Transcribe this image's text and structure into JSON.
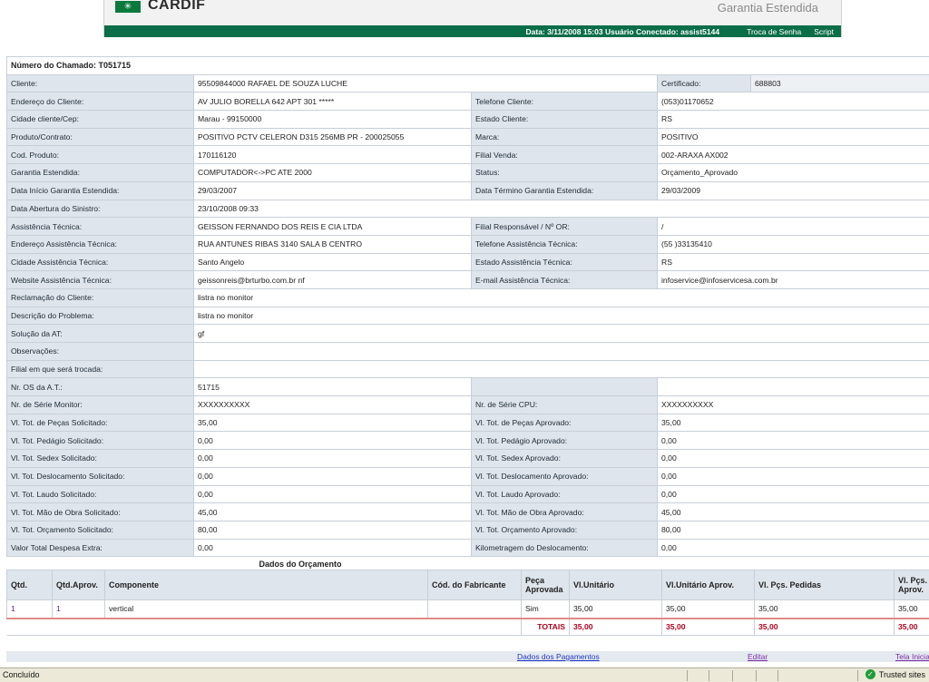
{
  "header": {
    "logo_text": "CARDIF",
    "product_title": "Garantia Estendida",
    "info": "Data: 3/11/2008 15:03  Usuário Conectado: assist5144",
    "link_senha": "Troca de Senha",
    "link_script": "Script"
  },
  "chamado": {
    "title": "Número do Chamado: T051715"
  },
  "fields": {
    "cliente": {
      "label": "Cliente:",
      "value": "95509844000  RAFAEL DE SOUZA LUCHE"
    },
    "certificado": {
      "label": "Certificado:",
      "value": "688803"
    },
    "endereco_cliente": {
      "label": "Endereço do Cliente:",
      "value": "AV JULIO BORELLA  642   APT 301   *****"
    },
    "telefone_cliente": {
      "label": "Telefone Cliente:",
      "value": "(053)01170652"
    },
    "cidade_cliente": {
      "label": "Cidade cliente/Cep:",
      "value": "Marau - 99150000"
    },
    "estado_cliente": {
      "label": "Estado Cliente:",
      "value": "RS"
    },
    "produto": {
      "label": "Produto/Contrato:",
      "value": "POSITIVO PCTV CELERON D315 256MB PR - 200025055"
    },
    "marca": {
      "label": "Marca:",
      "value": "POSITIVO"
    },
    "cod_produto": {
      "label": "Cod. Produto:",
      "value": "170116120"
    },
    "filial_venda": {
      "label": "Filial Venda:",
      "value": "002-ARAXA AX002"
    },
    "garantia": {
      "label": "Garantia Estendida:",
      "value": "COMPUTADOR<->PC ATE 2000"
    },
    "status": {
      "label": "Status:",
      "value": "Orçamento_Aprovado"
    },
    "inicio_garantia": {
      "label": "Data Início Garantia Estendida:",
      "value": "29/03/2007"
    },
    "termino_garantia": {
      "label": "Data Término Garantia Estendida:",
      "value": "29/03/2009"
    },
    "abertura_sinistro": {
      "label": "Data Abertura do Sinistro:",
      "value": "23/10/2008 09:33"
    },
    "assistencia": {
      "label": "Assistência Técnica:",
      "value": "GEISSON FERNANDO DOS REIS E CIA LTDA"
    },
    "filial_responsavel": {
      "label": "Filial Responsável / Nº OR:",
      "value": "/"
    },
    "endereco_at": {
      "label": "Endereço Assistência Técnica:",
      "value": "RUA ANTUNES RIBAS   3140   SALA B   CENTRO"
    },
    "telefone_at": {
      "label": "Telefone Assistência Técnica:",
      "value": "(55 )33135410"
    },
    "cidade_at": {
      "label": "Cidade Assistência Técnica:",
      "value": "Santo Angelo"
    },
    "estado_at": {
      "label": "Estado Assistência Técnica:",
      "value": "RS"
    },
    "website_at": {
      "label": "Website Assistência Técnica:",
      "value": "geissonreis@brturbo.com.br nf"
    },
    "email_at": {
      "label": "E-mail Assistência Técnica:",
      "value": "infoservice@infoservicesa.com.br"
    },
    "reclamacao": {
      "label": "Reclamação do Cliente:",
      "value": "listra no monitor"
    },
    "descricao": {
      "label": "Descrição do Problema:",
      "value": "listra no monitor"
    },
    "solucao": {
      "label": "Solução da AT:",
      "value": "gf"
    },
    "observacoes": {
      "label": "Observações:",
      "value": ""
    },
    "filial_troca": {
      "label": "Filial em que será trocada:",
      "value": ""
    },
    "nr_os": {
      "label": "Nr. OS da A.T.:",
      "value": "51715"
    },
    "serie_monitor": {
      "label": "Nr. de Série Monitor:",
      "value": "XXXXXXXXXX"
    },
    "serie_cpu": {
      "label": "Nr. de Série CPU:",
      "value": "XXXXXXXXXX"
    },
    "pecas_sol": {
      "label": "Vl. Tot. de Peças Solicitado:",
      "value": "35,00"
    },
    "pecas_apr": {
      "label": "Vl. Tot. de Peças Aprovado:",
      "value": "35,00"
    },
    "pedagio_sol": {
      "label": "Vl. Tot. Pedágio Solicitado:",
      "value": "0,00"
    },
    "pedagio_apr": {
      "label": "Vl. Tot. Pedágio Aprovado:",
      "value": "0,00"
    },
    "sedex_sol": {
      "label": "Vl. Tot. Sedex Solicitado:",
      "value": "0,00"
    },
    "sedex_apr": {
      "label": "Vl. Tot. Sedex Aprovado:",
      "value": "0,00"
    },
    "desloc_sol": {
      "label": "Vl. Tot. Deslocamento Solicitado:",
      "value": "0,00"
    },
    "desloc_apr": {
      "label": "Vl. Tot. Deslocamento Aprovado:",
      "value": "0,00"
    },
    "laudo_sol": {
      "label": "Vl. Tot. Laudo Solicitado:",
      "value": "0,00"
    },
    "laudo_apr": {
      "label": "Vl. Tot. Laudo Aprovado:",
      "value": "0,00"
    },
    "mao_obra_sol": {
      "label": "Vl. Tot. Mão de Obra Solicitado:",
      "value": "45,00"
    },
    "mao_obra_apr": {
      "label": "Vl. Tot. Mão de Obra Aprovado:",
      "value": "45,00"
    },
    "orcamento_sol": {
      "label": "Vl. Tot. Orçamento Solicitado:",
      "value": "80,00"
    },
    "orcamento_apr": {
      "label": "Vl. Tot. Orçamento Aprovado:",
      "value": "80,00"
    },
    "despesa_extra": {
      "label": "Valor Total Despesa Extra:",
      "value": "0,00"
    },
    "km_desloc": {
      "label": "Kilometragem do Deslocamento:",
      "value": "0,00"
    }
  },
  "budget": {
    "caption": "Dados do Orçamento",
    "headers": {
      "qtd": "Qtd.",
      "qtd_aprov": "Qtd.Aprov.",
      "componente": "Componente",
      "cod_fabricante": "Cód. do Fabricante",
      "peca_aprovada": "Peça Aprovada",
      "vl_unitario": "Vl.Unitário",
      "vl_unitario_aprov": "Vl.Unitário Aprov.",
      "pcs_pedidas": "Vl. Pçs. Pedidas",
      "pcs_aprov": "Vl. Pçs. Aprov."
    },
    "row": {
      "qtd": "1",
      "qtd_aprov": "1",
      "componente": "vertical",
      "cod_fabricante": "",
      "peca_aprovada": "Sim",
      "vl_unitario": "35,00",
      "vl_unitario_aprov": "35,00",
      "pcs_pedidas": "35,00",
      "pcs_aprov": "35,00"
    },
    "totals": {
      "label": "TOTAIS",
      "vl_unitario": "35,00",
      "vl_unitario_aprov": "35,00",
      "pcs_pedidas": "35,00",
      "pcs_aprov": "35,00"
    }
  },
  "footer": {
    "link_pagamentos": "Dados dos Pagamentos",
    "link_editar": "Editar",
    "link_tela": "Tela Inicial"
  },
  "statusbar": {
    "status": "Concluído",
    "zone": "Trusted sites",
    "zone_icon": "check-icon"
  },
  "colors": {
    "brand_green": "#0a6e49",
    "label_bg": "#dfe5ec",
    "totals_red": "#b2001e",
    "link_blue": "#2236c4"
  }
}
